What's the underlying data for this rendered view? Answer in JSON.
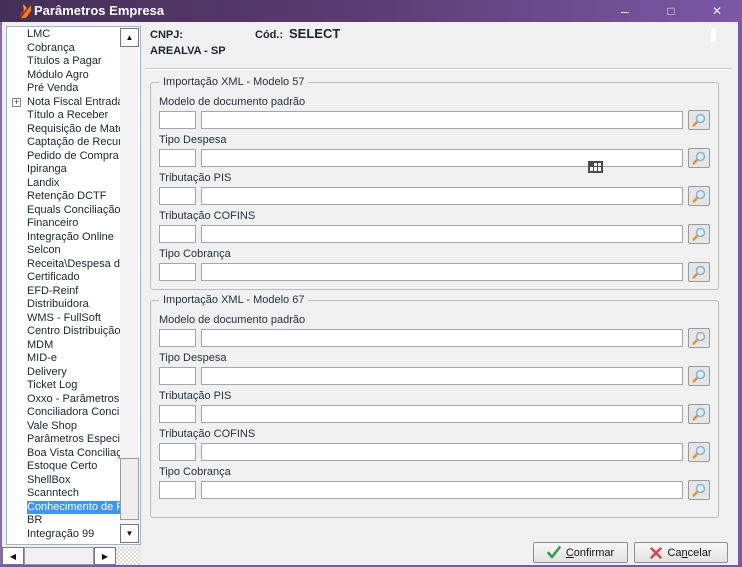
{
  "titlebar": {
    "title": "Parâmetros Empresa",
    "minimize": "–",
    "maximize": "□",
    "close": "✕"
  },
  "glyphs": {
    "plus": "+",
    "up": "▲",
    "down": "▼",
    "left": "◀",
    "right": "▶"
  },
  "sidebar": {
    "items": [
      {
        "label": "LMC"
      },
      {
        "label": "Cobrança"
      },
      {
        "label": "Títulos a Pagar"
      },
      {
        "label": "Módulo Agro"
      },
      {
        "label": "Pré Venda"
      },
      {
        "label": "Nota Fiscal Entrada",
        "expander": true
      },
      {
        "label": "Título a Receber"
      },
      {
        "label": "Requisição de Materia"
      },
      {
        "label": "Captação de Recurso"
      },
      {
        "label": "Pedido de Compra"
      },
      {
        "label": "Ipiranga"
      },
      {
        "label": "Landix"
      },
      {
        "label": "Retenção DCTF"
      },
      {
        "label": "Equals Conciliação"
      },
      {
        "label": "Financeiro"
      },
      {
        "label": "Integração Online"
      },
      {
        "label": "Selcon"
      },
      {
        "label": "Receita\\Despesa de T"
      },
      {
        "label": "Certificado"
      },
      {
        "label": "EFD-Reinf"
      },
      {
        "label": "Distribuidora"
      },
      {
        "label": "WMS - FullSoft"
      },
      {
        "label": "Centro Distribuição"
      },
      {
        "label": "MDM"
      },
      {
        "label": "MID-e"
      },
      {
        "label": "Delivery"
      },
      {
        "label": "Ticket Log"
      },
      {
        "label": "Oxxo - Parâmetros"
      },
      {
        "label": "Conciliadora Conciliaç"
      },
      {
        "label": "Vale Shop"
      },
      {
        "label": "Parâmetros Especiais"
      },
      {
        "label": "Boa Vista Conciliação"
      },
      {
        "label": "Estoque Certo"
      },
      {
        "label": "ShellBox"
      },
      {
        "label": "Scanntech"
      },
      {
        "label": "Conhecimento de Fre",
        "selected": true
      },
      {
        "label": "BR"
      },
      {
        "label": "Integração 99"
      }
    ]
  },
  "header": {
    "cnpj_label": "CNPJ:",
    "cod_label": "Cód.:",
    "cod_value": "SELECT",
    "branch": "AREALVA - SP"
  },
  "groups": [
    {
      "title": "Importação XML - Modelo 57",
      "fields": [
        {
          "label": "Modelo de documento padrão",
          "code": "",
          "description": ""
        },
        {
          "label": "Tipo Despesa",
          "code": "",
          "description": ""
        },
        {
          "label": "Tributação PIS",
          "code": "",
          "description": ""
        },
        {
          "label": "Tributação COFINS",
          "code": "",
          "description": ""
        },
        {
          "label": "Tipo Cobrança",
          "code": "",
          "description": ""
        }
      ]
    },
    {
      "title": "Importação XML - Modelo 67",
      "fields": [
        {
          "label": "Modelo de documento padrão",
          "code": "",
          "description": ""
        },
        {
          "label": "Tipo Despesa",
          "code": "",
          "description": ""
        },
        {
          "label": "Tributação PIS",
          "code": "",
          "description": ""
        },
        {
          "label": "Tributação COFINS",
          "code": "",
          "description": ""
        },
        {
          "label": "Tipo Cobrança",
          "code": "",
          "description": ""
        }
      ]
    }
  ],
  "footer": {
    "confirm": {
      "label": "Confirmar",
      "accel_index": 0
    },
    "cancel": {
      "label": "Cancelar",
      "accel_index": 2
    }
  },
  "colors": {
    "titlebar_start": "#443057",
    "titlebar_end": "#7c58a6",
    "selection_blue": "#3a95f5",
    "window_border": "#7a58a8",
    "content_bg": "#f0f0f0",
    "confirm_green": "#2f9e44",
    "cancel_red": "#d64545",
    "lookup_orange": "#e8922a"
  }
}
